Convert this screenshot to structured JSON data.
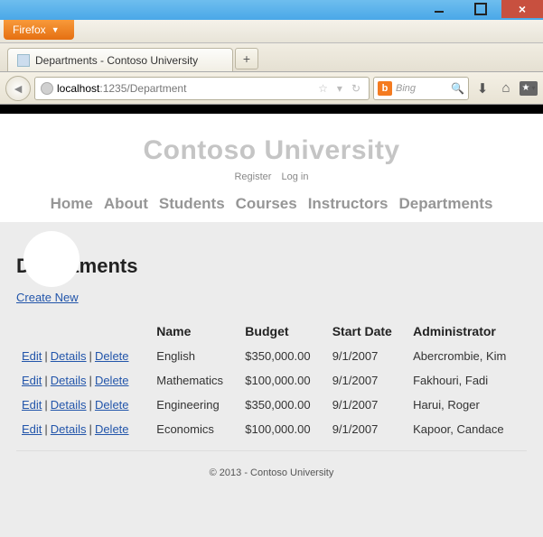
{
  "window": {
    "app_button": "Firefox",
    "tab_title": "Departments - Contoso University",
    "url_host": "localhost",
    "url_rest": ":1235/Department",
    "search_engine": "Bing"
  },
  "site": {
    "title": "Contoso University",
    "auth": {
      "register": "Register",
      "login": "Log in"
    },
    "nav": [
      "Home",
      "About",
      "Students",
      "Courses",
      "Instructors",
      "Departments"
    ]
  },
  "page": {
    "heading": "Departments",
    "create_label": "Create New",
    "action_labels": {
      "edit": "Edit",
      "details": "Details",
      "delete": "Delete"
    },
    "columns": [
      "Name",
      "Budget",
      "Start Date",
      "Administrator"
    ],
    "rows": [
      {
        "name": "English",
        "budget": "$350,000.00",
        "start": "9/1/2007",
        "admin": "Abercrombie, Kim"
      },
      {
        "name": "Mathematics",
        "budget": "$100,000.00",
        "start": "9/1/2007",
        "admin": "Fakhouri, Fadi"
      },
      {
        "name": "Engineering",
        "budget": "$350,000.00",
        "start": "9/1/2007",
        "admin": "Harui, Roger"
      },
      {
        "name": "Economics",
        "budget": "$100,000.00",
        "start": "9/1/2007",
        "admin": "Kapoor, Candace"
      }
    ]
  },
  "footer": "© 2013 - Contoso University"
}
